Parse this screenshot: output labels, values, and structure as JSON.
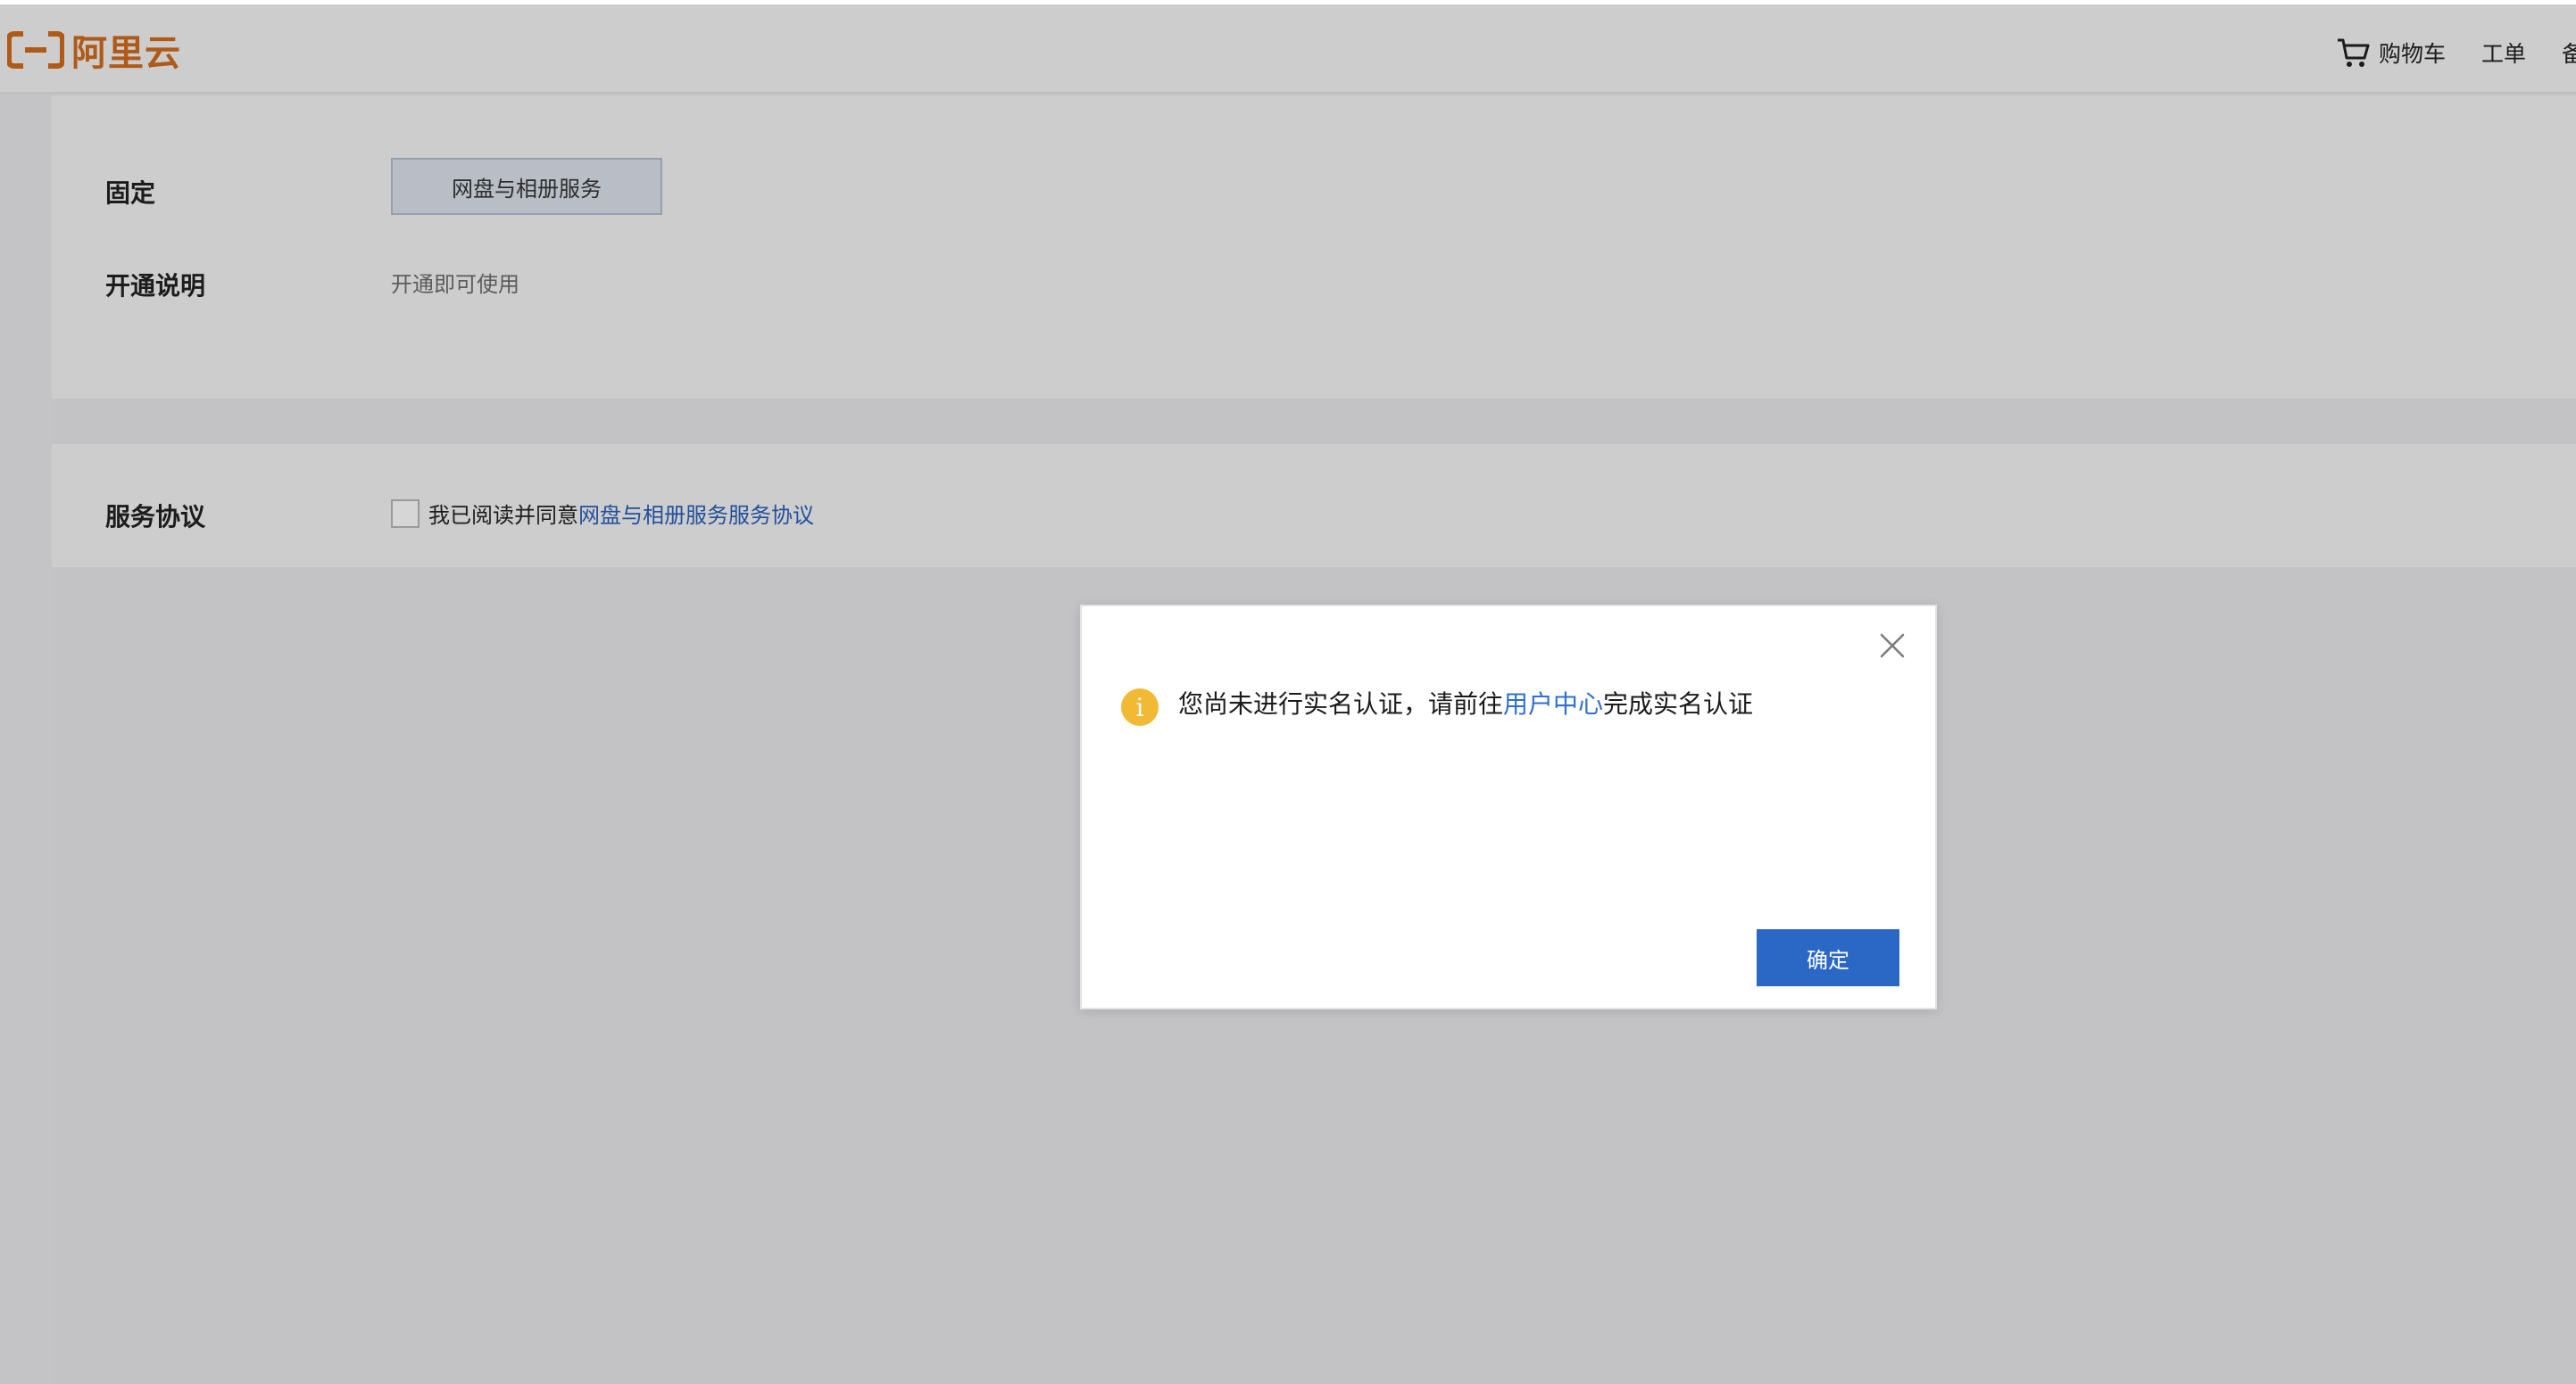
{
  "brand": {
    "name": "阿里云",
    "color": "#b05a18"
  },
  "nav": {
    "cart_label": "购物车",
    "tickets_label": "工单",
    "cut_label": "备"
  },
  "form": {
    "fixed_label": "固定",
    "fixed_value": "网盘与相册服务",
    "activation_label": "开通说明",
    "activation_value": "开通即可使用",
    "agreement_label": "服务协议",
    "agreement_text": "我已阅读并同意",
    "agreement_link": "网盘与相册服务服务协议",
    "agreement_checked": false
  },
  "modal": {
    "icon": "info-icon",
    "message_before": "您尚未进行实名认证，请前往",
    "message_link": "用户中心",
    "message_after": "完成实名认证",
    "confirm_label": "确定",
    "accent": "#2b67c4",
    "warn_color": "#f2b935"
  }
}
